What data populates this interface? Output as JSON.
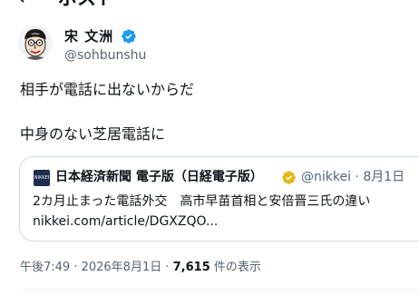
{
  "header": {
    "back_icon": "arrow-left-icon",
    "title": "ポスト"
  },
  "author": {
    "name": "宋 文洲",
    "handle": "@sohbunshu",
    "verified_icon": "verified-check-icon",
    "verified_color": "#1d9bf0"
  },
  "tweet": {
    "line1": "相手が電話に出ないからだ",
    "line2": "中身のない芝居電話に"
  },
  "card": {
    "logo_text": "NIKKEI",
    "source_name": "日本経済新聞 電子版（日経電子版）",
    "badge_icon": "gold-verified-icon",
    "badge_color": "#e2b719",
    "handle": "@nikkei · 8月1日",
    "headline": "2カ月止まった電話外交　高市早苗首相と安倍晋三氏の違い",
    "url": "nikkei.com/article/DGXZQO..."
  },
  "meta": {
    "timestamp": "午後7:49 · 2026年8月1日 · ",
    "views_count": "7,615",
    "views_label": " 件の表示"
  }
}
